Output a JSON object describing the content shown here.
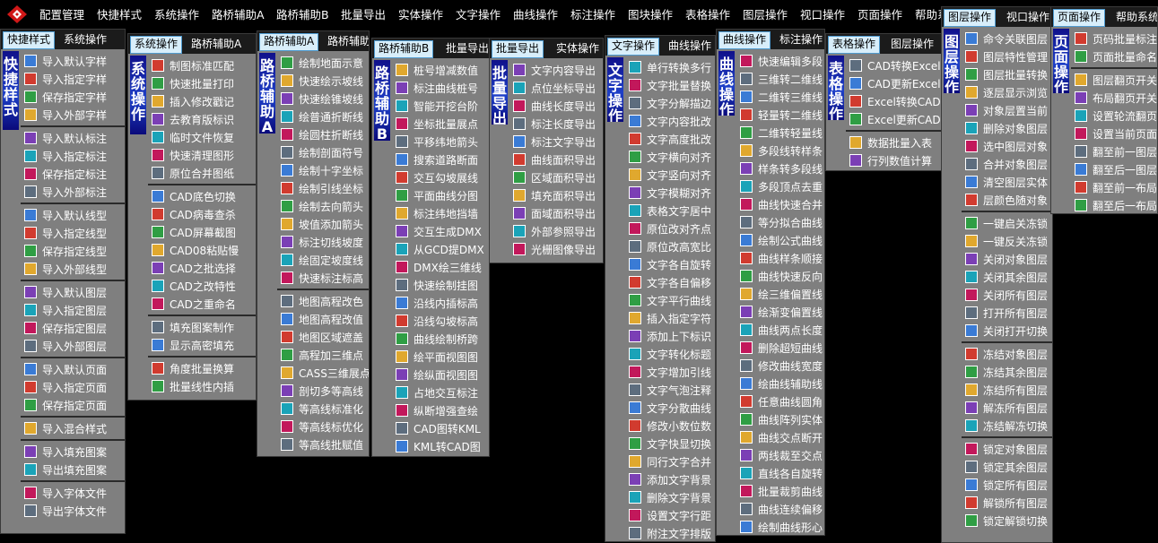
{
  "menubar": {
    "items": [
      "配置管理",
      "快捷样式",
      "系统操作",
      "路桥辅助A",
      "路桥辅助B",
      "批量导出",
      "实体操作",
      "文字操作",
      "曲线操作",
      "标注操作",
      "图块操作",
      "表格操作",
      "图层操作",
      "视口操作",
      "页面操作",
      "帮助系统"
    ]
  },
  "colors": {
    "accent_blue": "#1e40c8",
    "tab_active_bg": "#d8eefa",
    "panel_bg": "#7f7f7f"
  },
  "panels": [
    {
      "tabs": [
        "快捷样式",
        "系统操作"
      ],
      "vlabel": "快捷样式",
      "groups": [
        [
          "导入默认字样",
          "导入指定字样",
          "保存指定字样",
          "导入外部字样"
        ],
        [
          "导入默认标注",
          "导入指定标注",
          "保存指定标注",
          "导入外部标注"
        ],
        [
          "导入默认线型",
          "导入指定线型",
          "保存指定线型",
          "导入外部线型"
        ],
        [
          "导入默认图层",
          "导入指定图层",
          "保存指定图层",
          "导入外部图层"
        ],
        [
          "导入默认页面",
          "导入指定页面",
          "保存指定页面"
        ],
        [
          "导入混合样式"
        ],
        [
          "导入填充图案",
          "导出填充图案"
        ],
        [
          "导入字体文件",
          "导出字体文件"
        ]
      ]
    },
    {
      "tabs": [
        "系统操作",
        "路桥辅助A"
      ],
      "vlabel": "系统操作",
      "groups": [
        [
          "制图标准匹配",
          "快速批量打印",
          "插入修改戳记",
          "去教育版标识",
          "临时文件恢复",
          "快速清理图形",
          "原位合并图纸"
        ],
        [
          "CAD底色切换",
          "CAD病毒查杀",
          "CAD屏幕截图",
          "CAD08粘贴慢",
          "CAD之批选择",
          "CAD之改特性",
          "CAD之重命名"
        ],
        [
          "填充图案制作",
          "显示高密填充"
        ],
        [
          "角度批量换算",
          "批量线性内插"
        ]
      ]
    },
    {
      "tabs": [
        "路桥辅助A",
        "路桥辅助"
      ],
      "vlabel": "路桥辅助A",
      "groups": [
        [
          "绘制地面示意",
          "快速绘示坡线",
          "快速绘锥坡线",
          "绘普通折断线",
          "绘圆柱折断线",
          "绘制剖面符号",
          "绘制十字坐标",
          "绘制引线坐标",
          "绘制去向箭头",
          "坡值添加箭头",
          "标注切线坡度",
          "绘固定坡度线",
          "快速标注标高"
        ],
        [
          "地图高程改色",
          "地图高程改值",
          "地图区域遮盖",
          "高程加三维点",
          "CASS三维展点",
          "剖切多等高线",
          "等高线标准化",
          "等高线标优化",
          "等高线批赋值"
        ]
      ]
    },
    {
      "tabs": [
        "路桥辅助B",
        "批量导出"
      ],
      "vlabel": "路桥辅助B",
      "groups": [
        [
          "桩号增减数值",
          "标注曲线桩号",
          "智能开挖台阶",
          "坐标批量展点",
          "平移纬地箭头",
          "搜索道路断面",
          "交互勾坡展线",
          "平面曲线分图",
          "标注纬地挡墙",
          "交互生成DMX",
          "从GCD提DMX",
          "DMX绘三维线",
          "快速绘制挂图",
          "沿线内插标高",
          "沿线勾坡标高",
          "曲线绘制桥跨",
          "绘平面视图图",
          "绘纵面视图图",
          "占地交互标注",
          "纵断增强查绘",
          "CAD图转KML",
          "KML转CAD图"
        ]
      ]
    },
    {
      "tabs": [
        "批量导出",
        "实体操作"
      ],
      "vlabel": "批量导出",
      "groups": [
        [
          "文字内容导出",
          "点位坐标导出",
          "曲线长度导出",
          "标注长度导出",
          "标注文字导出",
          "曲线面积导出",
          "区域面积导出",
          "填充面积导出",
          "面域面积导出",
          "外部参照导出",
          "光栅图像导出"
        ]
      ]
    },
    {
      "tabs": [
        "文字操作",
        "曲线操作"
      ],
      "vlabel": "文字操作",
      "groups": [
        [
          "单行转换多行",
          "文字批量替换",
          "文字分解描边",
          "文字内容批改",
          "文字高度批改",
          "文字横向对齐",
          "文字竖向对齐",
          "文字模糊对齐",
          "表格文字居中",
          "原位改对齐点",
          "原位改高宽比",
          "文字各自旋转",
          "文字各自偏移",
          "文字平行曲线",
          "插入指定字符",
          "添加上下标识",
          "文字转化标题",
          "文字增加引线",
          "文字气泡注释",
          "文字分散曲线",
          "修改小数位数",
          "文字快显切换",
          "同行文字合并",
          "添加文字背景",
          "删除文字背景",
          "设置文字行距",
          "附注文字排版"
        ]
      ]
    },
    {
      "tabs": [
        "曲线操作",
        "标注操作"
      ],
      "vlabel": "曲线操作",
      "groups": [
        [
          "快速编辑多段",
          "三维转二维线",
          "二维转三维线",
          "轻量转二维线",
          "二维转轻量线",
          "多段线转样条",
          "样条转多段线",
          "多段顶点去重",
          "曲线快速合并",
          "等分拟合曲线",
          "绘制公式曲线",
          "曲线样条顺接",
          "曲线快速反向",
          "绘三维偏置线",
          "绘渐变偏置线",
          "曲线两点长度",
          "删除超短曲线",
          "修改曲线宽度",
          "绘曲线辅助线",
          "任意曲线圆角",
          "曲线阵列实体",
          "曲线交点断开",
          "两线裁至交点",
          "直线各自旋转",
          "批量裁剪曲线",
          "曲线连续偏移",
          "绘制曲线形心"
        ]
      ]
    },
    {
      "tabs": [
        "表格操作",
        "图层操作"
      ],
      "vlabel": "表格操作",
      "groups": [
        [
          "CAD转换Excel",
          "CAD更新Excel",
          "Excel转换CAD",
          "Excel更新CAD"
        ],
        [
          "数据批量入表",
          "行列数值计算"
        ]
      ]
    },
    {
      "tabs": [
        "图层操作",
        "视口操作"
      ],
      "vlabel": "图层操作",
      "groups": [
        [
          "命令关联图层",
          "图层特性管理",
          "图层批量转换",
          "逐层显示浏览",
          "对象层置当前",
          "删除对象图层",
          "选中图层对象",
          "合并对象图层",
          "清空图层实体",
          "层颜色随对象"
        ],
        [
          "一键启关冻锁",
          "一键反关冻锁",
          "关闭对象图层",
          "关闭其余图层",
          "关闭所有图层",
          "打开所有图层",
          "关闭打开切换"
        ],
        [
          "冻结对象图层",
          "冻结其余图层",
          "冻结所有图层",
          "解冻所有图层",
          "冻结解冻切换"
        ],
        [
          "锁定对象图层",
          "锁定其余图层",
          "锁定所有图层",
          "解锁所有图层",
          "锁定解锁切换"
        ]
      ]
    },
    {
      "tabs": [
        "页面操作",
        "帮助系统"
      ],
      "vlabel": "页面操作",
      "groups": [
        [
          "页码批量标注",
          "页面批量命名"
        ],
        [
          "图层翻页开关",
          "布局翻页开关",
          "设置轮流翻页",
          "设置当前页面",
          "翻至前一图层",
          "翻至后一图层",
          "翻至前一布局",
          "翻至后一布局"
        ]
      ]
    }
  ]
}
